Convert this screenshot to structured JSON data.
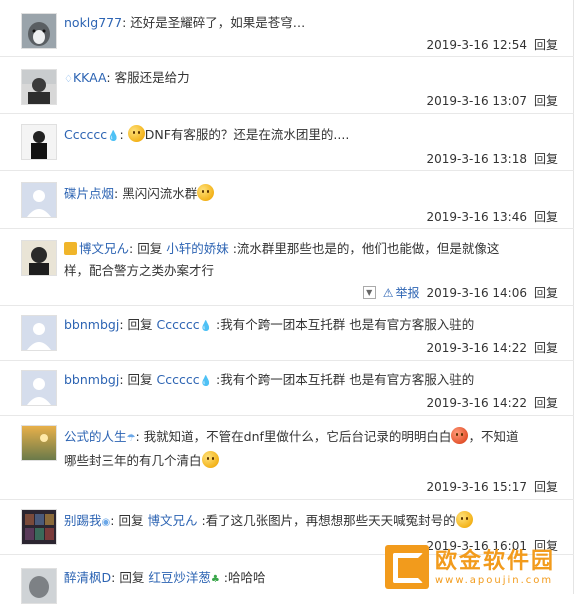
{
  "comments": [
    {
      "user": "noklg777",
      "text": "还好是圣耀碎了，如果是苍穹…",
      "time": "2019-3-16 12:54",
      "reply": "回复"
    },
    {
      "user": "KKAA",
      "text": "客服还是给力",
      "time": "2019-3-16 13:07",
      "reply": "回复"
    },
    {
      "user": "Cccccc",
      "text": "DNF有客服的？还是在流水团里的....",
      "time": "2019-3-16 13:18",
      "reply": "回复"
    },
    {
      "user": "碟片点烟",
      "text": "黑闪闪流水群",
      "time": "2019-3-16 13:46",
      "reply": "回复"
    },
    {
      "user": "博文兄ん",
      "reply_prefix": "回复",
      "reply_to": "小轩的娇妹",
      "text": ":流水群里那些也是的，他们也能做，但是就像这",
      "text2": "样，配合警方之类办案才行",
      "report": "举报",
      "time": "2019-3-16 14:06",
      "reply": "回复"
    },
    {
      "user": "bbnmbgj",
      "reply_prefix": "回复",
      "reply_to": "Cccccc",
      "text": ":我有个跨一团本互托群 也是有官方客服入驻的",
      "time": "2019-3-16 14:22",
      "reply": "回复"
    },
    {
      "user": "bbnmbgj",
      "reply_prefix": "回复",
      "reply_to": "Cccccc",
      "text": ":我有个跨一团本互托群 也是有官方客服入驻的",
      "time": "2019-3-16 14:22",
      "reply": "回复"
    },
    {
      "user": "公式的人生",
      "text": "我就知道，不管在dnf里做什么，它后台记录的明明白白",
      "text_after": "，不知道",
      "text2": "哪些封三年的有几个清白",
      "time": "2019-3-16 15:17",
      "reply": "回复"
    },
    {
      "user": "别踢我",
      "reply_prefix": "回复",
      "reply_to": "博文兄ん",
      "text": ":看了这几张图片，再想想那些天天喊冤封号的",
      "time": "2019-3-16 16:01",
      "reply": "回复"
    },
    {
      "user": "醉清枫D",
      "reply_prefix": "回复",
      "reply_to": "红豆炒洋葱",
      "text": ":哈哈哈",
      "time": "",
      "reply": ""
    }
  ],
  "watermark": {
    "title": "欧金软件园",
    "url": "www.apoujin.com"
  }
}
